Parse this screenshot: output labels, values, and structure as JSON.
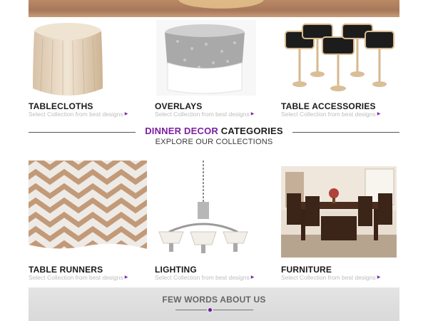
{
  "top_banner": {
    "alt": "gold sequin banner"
  },
  "row1": [
    {
      "title": "TABLECLOTHS",
      "subtitle": "Select Collection from best designs"
    },
    {
      "title": "OVERLAYS",
      "subtitle": "Select Collection from best designs"
    },
    {
      "title": "TABLE ACCESSORIES",
      "subtitle": "Select Collection from best designs"
    }
  ],
  "section_heading": {
    "accent": "DINNER DECOR",
    "rest": " CATEGORIES",
    "subtitle": "EXPLORE OUR COLLECTIONS"
  },
  "row2": [
    {
      "title": "TABLE RUNNERS",
      "subtitle": "Select Collection from best designs"
    },
    {
      "title": "LIGHTING",
      "subtitle": "Select Collection from best designs"
    },
    {
      "title": "FURNITURE",
      "subtitle": "Select Collection from best designs"
    }
  ],
  "about": {
    "title": "FEW WORDS ABOUT US"
  },
  "colors": {
    "accent": "#7b1fa2",
    "arrow": "#7b2aa8"
  },
  "icons": {
    "subtitle_arrow": "triangle-right-icon"
  }
}
